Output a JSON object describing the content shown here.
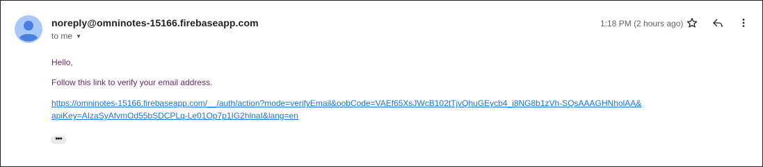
{
  "email": {
    "sender": "noreply@omninotes-15166.firebaseapp.com",
    "recipient_label": "to me",
    "time": "1:18 PM (2 hours ago)",
    "greeting": "Hello,",
    "instruction": "Follow this link to verify your email address.",
    "link_line1": "https://omninotes-15166.firebaseapp.com/__/auth/action?mode=verifyEmail&oobCode=VAEf65XsJWcB102tTjvQhuGEycb4_i8NG8b1zVh-SQsAAAGHNholAA&",
    "link_line2": "apiKey=AIzaSyAfvmOd55bSDCPLq-Le01Op7p1IG2hlnaI&lang=en",
    "more_label": "•••"
  },
  "icons": {
    "avatar": "avatar-person-icon",
    "star": "star-icon",
    "reply": "reply-icon",
    "more": "more-vert-icon",
    "caret": "caret-down-icon"
  },
  "colors": {
    "avatar": "#6e9ee8",
    "body_text": "#6d2a6b",
    "link": "#1a73e8"
  }
}
